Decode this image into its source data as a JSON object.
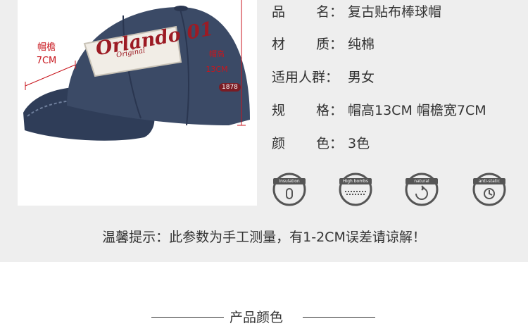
{
  "photo": {
    "brim_label_line1": "帽檐",
    "brim_label_line2": "7CM",
    "height_label_line1": "帽高",
    "height_label_line2": "13CM",
    "patch_text": "Orlando 01",
    "patch_subtext": "Original",
    "side_text": "1878"
  },
  "specs": [
    {
      "k1": "品",
      "k2": "名",
      "colon": "：",
      "value": "复古贴布棒球帽"
    },
    {
      "k1": "材",
      "k2": "质",
      "colon": "：",
      "value": "纯棉"
    },
    {
      "key_full": "适用人群：",
      "value": "男女"
    },
    {
      "k1": "规",
      "k2": "格",
      "colon": "：",
      "value": "帽高13CM 帽檐宽7CM"
    },
    {
      "k1": "颜",
      "k2": "色",
      "colon": "：",
      "value": "3色"
    }
  ],
  "features": [
    {
      "label": "Insulation",
      "icon": "insulation-icon"
    },
    {
      "label": "High bombs",
      "icon": "high-bombs-icon"
    },
    {
      "label": "natural",
      "icon": "natural-icon"
    },
    {
      "label": "anti-static",
      "icon": "anti-static-icon"
    }
  ],
  "note": "温馨提示：此参数为手工测量，有1-2CM误差请谅解！",
  "section_title": "产品颜色",
  "colors": {
    "accent_red": "#c8161d",
    "cap_navy": "#3b4a66",
    "text": "#333333",
    "panel_bg": "#eeeeee"
  }
}
